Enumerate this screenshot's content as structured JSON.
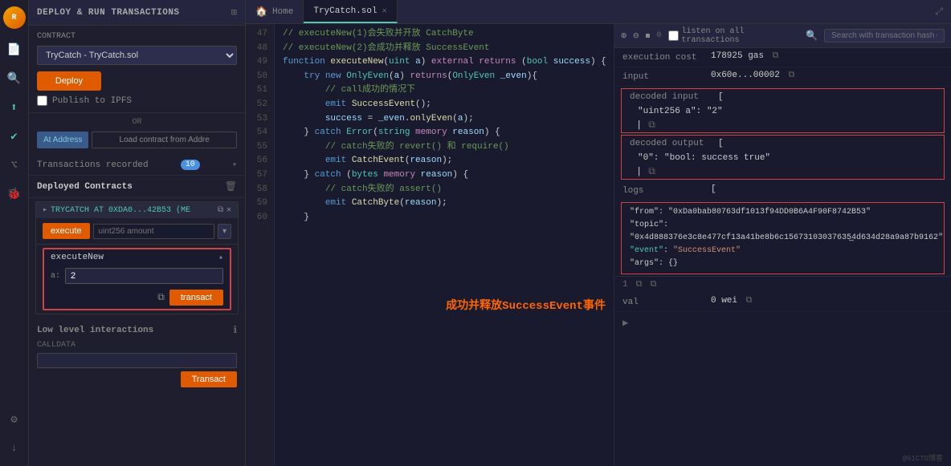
{
  "app": {
    "title": "DEPLOY & RUN TRANSACTIONS"
  },
  "tabs": {
    "home": {
      "label": "Home",
      "icon": "🏠",
      "active": false
    },
    "trycatch": {
      "label": "TryCatch.sol",
      "active": true,
      "closable": true
    }
  },
  "panel": {
    "contract_label": "CONTRACT",
    "contract_value": "TryCatch - TryCatch.sol",
    "deploy_button": "Deploy",
    "publish_ipfs": "Publish to IPFS",
    "or_label": "OR",
    "at_address_button": "At Address",
    "load_button": "Load contract from Addre",
    "tx_recorded_label": "Transactions recorded",
    "tx_count": "10",
    "deployed_contracts_label": "Deployed Contracts",
    "contract_instance": "TRYCATCH AT 0XDA0...42B53 (ME",
    "execute_button": "execute",
    "amount_placeholder": "uint256 amount",
    "executeNew_label": "executeNew",
    "param_a_label": "a:",
    "param_a_value": "2",
    "transact_button": "transact",
    "low_level_label": "Low level interactions",
    "calldata_label": "CALLDATA",
    "transact_low_button": "Transact"
  },
  "output": {
    "toolbar": {
      "search_placeholder": "Search with transaction hash or address"
    },
    "listen_label": "listen on all transactions",
    "execution_cost_label": "execution cost",
    "execution_cost_value": "178925 gas",
    "input_label": "input",
    "input_value": "0x60e...00002",
    "decoded_input_label": "decoded input",
    "decoded_input_bracket_open": "[",
    "decoded_input_value": "\"uint256 a\": \"2\"",
    "decoded_input_copy": "⧉",
    "decoded_output_label": "decoded output",
    "decoded_output_bracket_open": "[",
    "decoded_output_value": "\"0\": \"bool: success true\"",
    "decoded_output_copy": "⧉",
    "logs_label": "logs",
    "logs_bracket": "[",
    "log_from": "\"from\": \"0xDa0bab80763df1013f94DD0B6A4F90F8742B53\"",
    "log_topic": "\"topic\": \"0x4d888376e3c8e477cf13a41be8b6c15673103037635̲4d634d28a9a87b9162\"",
    "log_event": "\"event\": \"SuccessEvent\"",
    "log_args": "\"args\": {}",
    "val_label": "val",
    "val_value": "0 wei",
    "footer_index": "1"
  },
  "callout_text": "成功并释放SuccessEvent事件",
  "watermark": "@61CTO博客",
  "code_lines": [
    {
      "num": "47",
      "content": "// executeNew(1)会失败并开放 CatchByte"
    },
    {
      "num": "48",
      "content": "// executeNew(2)会成功并释放 SuccessEvent"
    },
    {
      "num": "49",
      "content": "function executeNew(uint a) external returns (bool success) {"
    },
    {
      "num": "50",
      "content": "    try new OnlyEven(a) returns(OnlyEven _even){"
    },
    {
      "num": "51",
      "content": "        // call成功的情况下"
    },
    {
      "num": "52",
      "content": "        emit SuccessEvent();"
    },
    {
      "num": "53",
      "content": "        success = _even.onlyEven(a);"
    },
    {
      "num": "54",
      "content": "    } catch Error(string memory reason) {"
    },
    {
      "num": "55",
      "content": "        // catch失败的 revert() 和 require()"
    },
    {
      "num": "56",
      "content": "        emit CatchEvent(reason);"
    },
    {
      "num": "57",
      "content": "    } catch (bytes memory reason) {"
    },
    {
      "num": "58",
      "content": "        // catch失败的 assert()"
    },
    {
      "num": "59",
      "content": "        emit CatchByte(reason);"
    },
    {
      "num": "60",
      "content": "    }"
    }
  ]
}
